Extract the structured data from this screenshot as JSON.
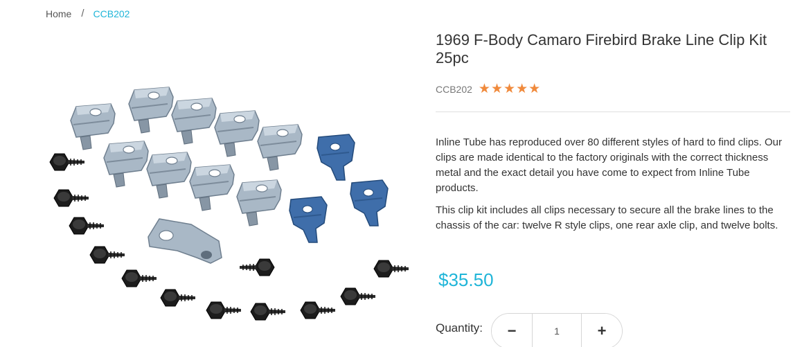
{
  "breadcrumb": {
    "home": "Home",
    "separator": "/",
    "current": "CCB202"
  },
  "product": {
    "title": "1969 F-Body Camaro Firebird Brake Line Clip Kit 25pc",
    "sku": "CCB202",
    "rating_stars": 5,
    "description": [
      "Inline Tube has reproduced over 80 different styles of hard to find clips. Our clips are made identical to the factory originals with the correct thickness metal and the exact detail you have come to expect from Inline Tube products.",
      "This clip kit includes all clips necessary to secure all the brake lines to the chassis of the car: twelve R style clips, one rear axle clip, and twelve bolts."
    ],
    "price": "$35.50"
  },
  "quantity": {
    "label": "Quantity:",
    "value": "1",
    "minus_label": "−",
    "plus_label": "+"
  },
  "colors": {
    "accent": "#1fb5d8",
    "star": "#f08a3c",
    "zinc_clip": "#a9b8c6",
    "blue_clip": "#3f6eaa",
    "bolt": "#1c1c1c"
  }
}
